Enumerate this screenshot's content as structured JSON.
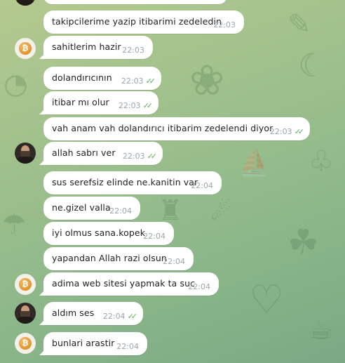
{
  "messages": [
    {
      "text": "takipcilerime yazip itibarimi zedeledin",
      "time": "22:03",
      "read": false
    },
    {
      "text": "sahitlerim hazir",
      "time": "22:03",
      "read": false
    },
    {
      "text": "dolandırıcının",
      "time": "22:03",
      "read": true
    },
    {
      "text": "itibar mı olur",
      "time": "22:03",
      "read": true
    },
    {
      "text": "vah anam vah dolandırıcı itibarim zedelendi diyor",
      "time": "22:03",
      "read": true
    },
    {
      "text": "allah sabrı ver",
      "time": "22:03",
      "read": true
    },
    {
      "text": "sus serefsiz elinde ne.kanitin var",
      "time": "22:04",
      "read": false
    },
    {
      "text": "ne.gizel valla",
      "time": "22:04",
      "read": false
    },
    {
      "text": "iyi olmus sana.kopek",
      "time": "22:04",
      "read": false
    },
    {
      "text": "yapandan Allah razi olsun",
      "time": "22:04",
      "read": false
    },
    {
      "text": "adima web sitesi yapmak ta suc",
      "time": "22:04",
      "read": false
    },
    {
      "text": "aldım ses",
      "time": "22:04",
      "read": true
    },
    {
      "text": "bunlari arastir",
      "time": "22:04",
      "read": false
    }
  ],
  "avatars": {
    "coin_glyph": "₿",
    "coin_icon": "bitcoin-avatar-icon",
    "person_icon": "person-avatar-icon"
  },
  "colors": {
    "bubble": "#ffffff",
    "time": "#9aa6ad",
    "read_check": "#5fb05a",
    "background": "#9fc08c"
  }
}
